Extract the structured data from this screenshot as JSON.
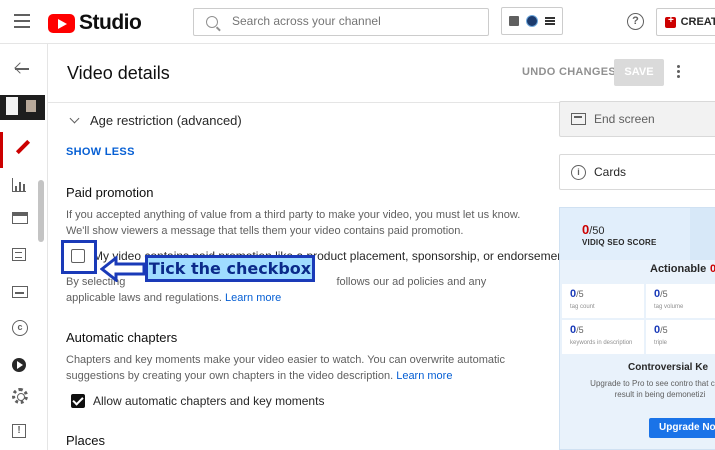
{
  "app": {
    "logo_text": "Studio"
  },
  "search": {
    "placeholder": "Search across your channel"
  },
  "header": {
    "create_label": "CREATE",
    "help_symbol": "?"
  },
  "page": {
    "title": "Video details",
    "undo_label": "UNDO CHANGES",
    "save_label": "SAVE"
  },
  "sections": {
    "age_restriction": "Age restriction (advanced)",
    "show_less": "SHOW LESS",
    "paid_promotion": {
      "heading": "Paid promotion",
      "description": "If you accepted anything of value from a third party to make your video, you must let us know. We'll show viewers a message that tells them your video contains paid promotion.",
      "checkbox_label": "My video contains paid promotion like a product placement, sponsorship, or endorsement",
      "checked": false,
      "note_prefix": "By selecting",
      "note_middle": "follows our ad policies and any applicable laws and regulations.",
      "learn_more": "Learn more"
    },
    "chapters": {
      "heading": "Automatic chapters",
      "description": "Chapters and key moments make your video easier to watch. You can overwrite automatic suggestions by creating your own chapters in the video description.",
      "learn_more": "Learn more",
      "checkbox_label": "Allow automatic chapters and key moments",
      "checked": true
    },
    "places": {
      "heading": "Places"
    }
  },
  "annotation": {
    "label": "Tick the checkbox",
    "color": "#1a3ab8",
    "fill": "#9fdcff"
  },
  "right_panel": {
    "end_screen": "End screen",
    "cards": "Cards",
    "vidiq": {
      "score_value": "0",
      "score_max": "/50",
      "score_label": "VIDIQ SEO SCORE",
      "actionable": "Actionable",
      "actionable_count": "0",
      "metrics": [
        {
          "value": "0",
          "max": "/5",
          "label": "tag count"
        },
        {
          "value": "0",
          "max": "/5",
          "label": "tag volume"
        },
        {
          "value": "0",
          "max": "/5",
          "label": "keywords in description"
        },
        {
          "value": "0",
          "max": "/5",
          "label": "triple"
        }
      ],
      "controversial_title": "Controversial Ke",
      "controversial_text": "Upgrade to Pro to see contro that could result in being demonetizi",
      "upgrade_label": "Upgrade No"
    }
  },
  "colors": {
    "accent": "#065fd4",
    "brand_red": "#ff0000",
    "nav_active": "#cc0000"
  }
}
